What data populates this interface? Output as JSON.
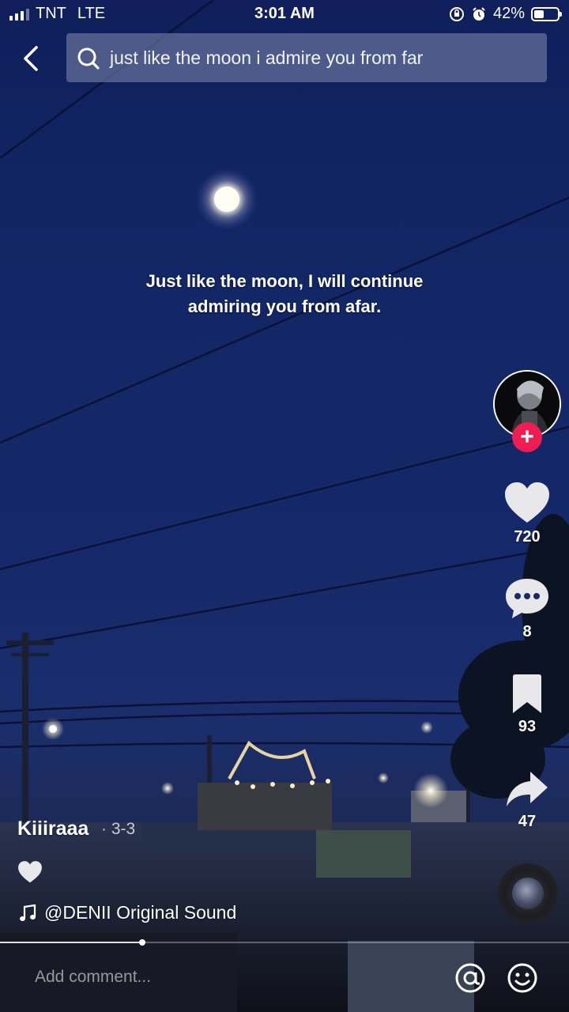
{
  "status_bar": {
    "carrier": "TNT",
    "network": "LTE",
    "time": "3:01 AM",
    "battery": "42%",
    "battery_level": 0.42
  },
  "search": {
    "query": "just like the moon i admire you from far"
  },
  "video": {
    "caption": "Just like the moon, I will continue admiring you from afar."
  },
  "rail": {
    "likes": "720",
    "comments": "8",
    "bookmarks": "93",
    "shares": "47"
  },
  "post": {
    "username": "Kiiiraaa",
    "date": "· 3-3",
    "sound": "@DENII Original Sound",
    "progress": 0.25
  },
  "comment": {
    "placeholder": "Add comment..."
  },
  "colors": {
    "follow_plus": "#ee1d52",
    "sky": "#132766"
  }
}
